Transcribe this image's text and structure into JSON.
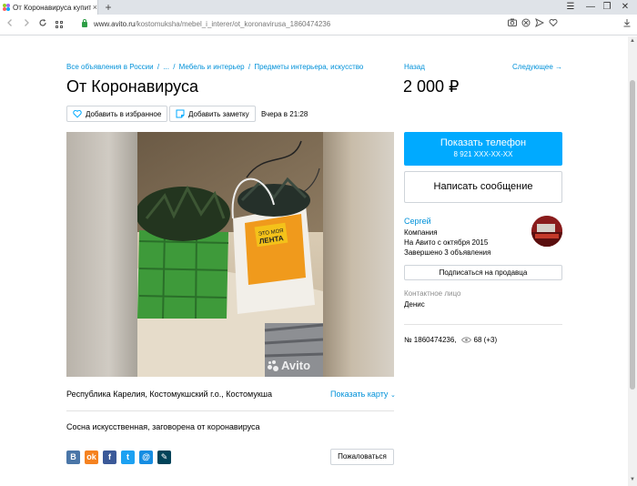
{
  "browser": {
    "tab_title": "От Коронавируса купить в",
    "tab_close": "×",
    "new_tab": "+",
    "url_host": "www.avito.ru",
    "url_path": "/kostomuksha/mebel_i_interer/ot_koronavirusa_1860474236",
    "window_controls": [
      "☰",
      "—",
      "❐",
      "✕"
    ]
  },
  "breadcrumbs": {
    "items": [
      "Все объявления в России",
      "...",
      "Мебель и интерьер",
      "Предметы интерьера, искусство"
    ],
    "separator": "/"
  },
  "ad": {
    "title": "От Коронавируса",
    "price": "2 000 ₽",
    "back_label": "Назад",
    "next_label": "Следующее →",
    "add_favorite_label": "Добавить в избранное",
    "add_note_label": "Добавить заметку",
    "posted_time": "Вчера в 21:28",
    "watermark": "Avito",
    "location": "Республика Карелия, Костомукшский г.о., Костомукша",
    "show_map_label": "Показать карту",
    "description": "Сосна искусственная, заговорена от коронавируса",
    "complain_label": "Пожаловаться",
    "ad_number": "№ 1860474236,",
    "views": "68 (+3)"
  },
  "contact": {
    "phone_button_label": "Показать телефон",
    "phone_masked": "8 921 XXX-XX-XX",
    "message_button_label": "Написать сообщение",
    "seller_name": "Сергей",
    "seller_type": "Компания",
    "seller_since": "На Авито с октября 2015",
    "seller_ads": "Завершено 3 объявления",
    "subscribe_label": "Подписаться на продавца",
    "contact_person_label": "Контактное лицо",
    "contact_person_name": "Денис"
  },
  "share": {
    "vk": "В",
    "ok": "ok",
    "fb": "f",
    "tw": "t",
    "mail": "@",
    "lj": "✎"
  },
  "colors": {
    "accent": "#00aaff",
    "link": "#0091d9",
    "vk": "#4a76a8",
    "ok": "#f58220",
    "fb": "#3b5998",
    "tw": "#1da1f2",
    "mail": "#168de2",
    "lj": "#004359"
  }
}
